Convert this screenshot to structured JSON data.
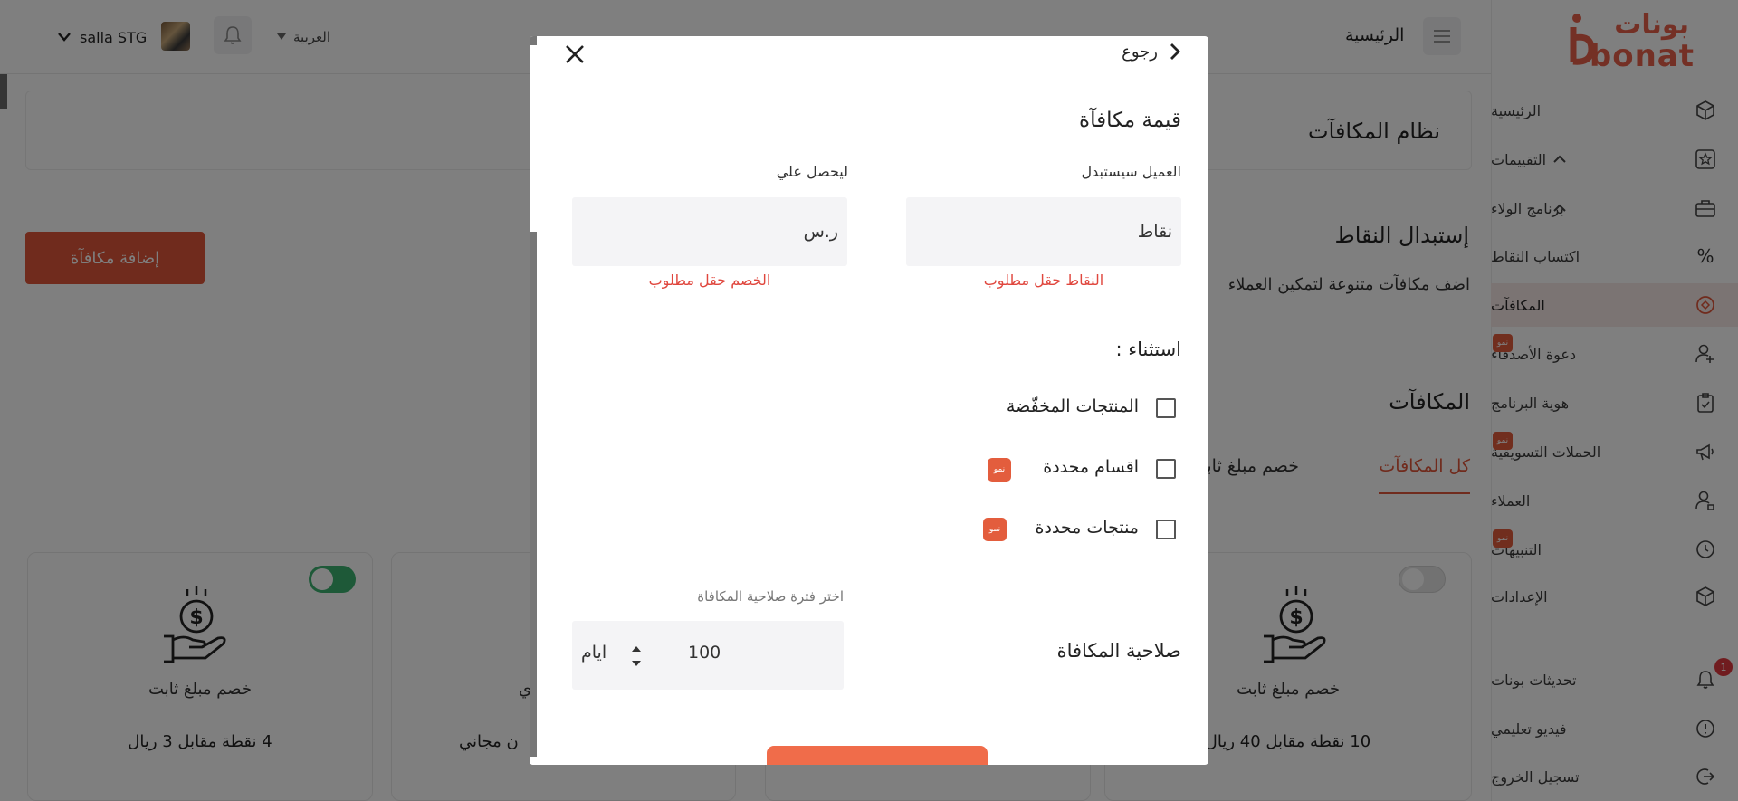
{
  "header": {
    "store_name": "salla STG",
    "language": "العربية",
    "home_label": "الرئيسية"
  },
  "sidebar": {
    "logo_ar": "بونات",
    "logo_en": "bonat",
    "items": [
      {
        "label": "الرئيسية",
        "icon": "cube-icon"
      },
      {
        "label": "التقييمات",
        "icon": "star-icon"
      },
      {
        "label": "برنامج الولاء",
        "icon": "briefcase-icon"
      },
      {
        "label": "اكتساب النقاط",
        "icon": "percent-icon"
      },
      {
        "label": "المكافآت",
        "icon": "reward-icon"
      },
      {
        "label": "دعوة الأصدقاء",
        "icon": "add-user-icon",
        "badge": "نمو"
      },
      {
        "label": "هوية البرنامج",
        "icon": "clipboard-icon"
      },
      {
        "label": "الحملات التسويقية",
        "icon": "megaphone-icon",
        "badge": "نمو"
      },
      {
        "label": "العملاء",
        "icon": "user-icon"
      },
      {
        "label": "التنبيهات",
        "icon": "clock-icon",
        "badge": "نمو"
      },
      {
        "label": "الإعدادات",
        "icon": "cube-icon"
      }
    ],
    "bottom_items": [
      {
        "label": "تحديثات بونات",
        "icon": "bell-icon",
        "count": "1"
      },
      {
        "label": "فيديو تعليمي",
        "icon": "info-icon"
      },
      {
        "label": "تسجيل الخروج",
        "icon": "logout-icon"
      }
    ]
  },
  "main": {
    "page_title": "نظام المكافآت",
    "add_reward_button": "إضافة مكافآة",
    "section_title": "إستبدال النقاط",
    "section_desc": "اضف مكافآت متنوعة لتمكين العملاء",
    "rewards_title": "المكافآت",
    "tabs": [
      "كل المكافآت",
      "خصم مبلغ ثابت"
    ],
    "cards": [
      {
        "title": "خصم مبلغ ثابت",
        "subtitle": "10 نقطة مقابل 40 ريال",
        "enabled": false
      },
      {
        "title": "ي",
        "subtitle": "ن مجاني",
        "enabled": false
      },
      {
        "title": "خصم مبلغ ثابت",
        "subtitle": "4 نقطة مقابل 3 ريال",
        "enabled": true
      }
    ]
  },
  "modal": {
    "back_label": "رجوع",
    "reward_value_title": "قيمة مكافآة",
    "customer_redeems_label": "العميل سيستبدل",
    "points_value": "نقاط",
    "points_error": "النقاط حقل مطلوب",
    "gets_label": "ليحصل علي",
    "currency_value": "ر.س",
    "discount_error": "الخصم حقل مطلوب",
    "exception_title": "استثناء :",
    "exceptions": [
      {
        "label": "المنتجات المخفّضة",
        "checked": false,
        "badge": ""
      },
      {
        "label": "اقسام محددة",
        "checked": false,
        "badge": "نمو"
      },
      {
        "label": "منتجات محددة",
        "checked": false,
        "badge": "نمو"
      }
    ],
    "validity_hint": "اختر فترة صلاحية المكافاة",
    "validity_title": "صلاحية المكافاة",
    "validity_value": "100",
    "validity_unit": "ايام"
  },
  "colors": {
    "brand": "#e8614a",
    "error": "#e0473e",
    "toggle_on": "#3cb371",
    "toggle_off": "#e4e4e4"
  }
}
